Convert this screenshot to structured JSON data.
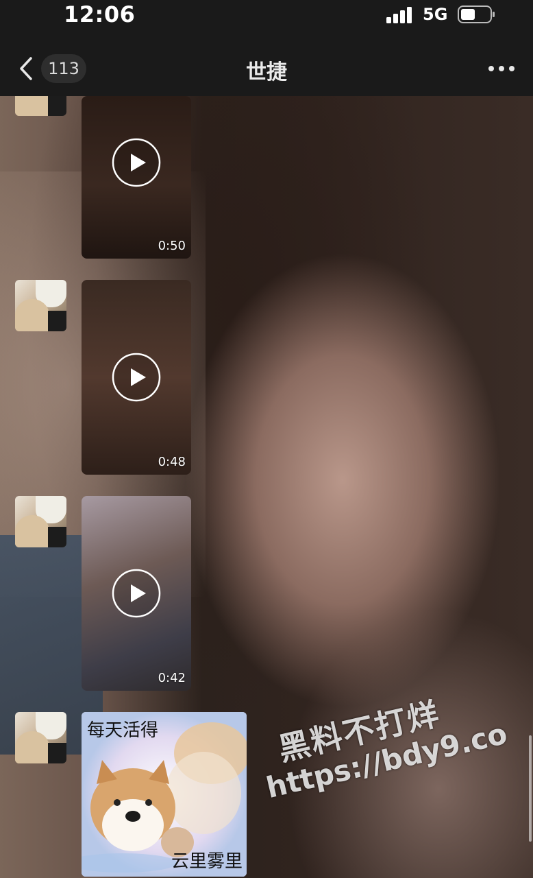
{
  "status_bar": {
    "time": "12:06",
    "network": "5G",
    "icons": [
      "signal-icon",
      "battery-icon"
    ]
  },
  "nav": {
    "back_count": "113",
    "title": "世捷",
    "icons": [
      "back-chevron-icon",
      "more-icon"
    ]
  },
  "messages": [
    {
      "type": "video",
      "duration": "0:50"
    },
    {
      "type": "video",
      "duration": "0:48"
    },
    {
      "type": "video",
      "duration": "0:42"
    },
    {
      "type": "sticker",
      "top_text": "每天活得",
      "bottom_text": "云里雾里"
    }
  ],
  "watermark": {
    "line1": "黑料不打烊",
    "line2": "https://bdy9.co"
  },
  "colors": {
    "bar_background": "#1a1a1a",
    "text": "#ffffff"
  }
}
